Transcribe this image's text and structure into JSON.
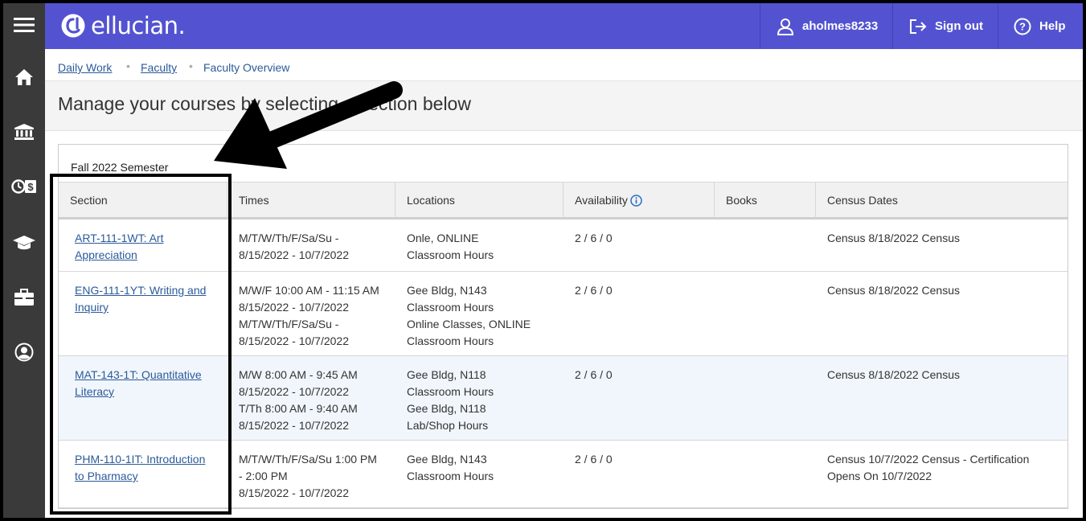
{
  "sidebar": {
    "icons": [
      "menu-icon",
      "home-icon",
      "bank-icon",
      "finance-icon",
      "graduation-cap-icon",
      "briefcase-icon",
      "user-circle-icon"
    ]
  },
  "header": {
    "logo_text": "ellucian.",
    "username": "aholmes8233",
    "signout_label": "Sign out",
    "help_label": "Help",
    "brand_color": "#5353d1"
  },
  "breadcrumb": {
    "items": [
      "Daily Work",
      "Faculty",
      "Faculty Overview"
    ]
  },
  "page": {
    "heading": "Manage your courses by selecting a section below"
  },
  "table": {
    "semester": "Fall 2022 Semester",
    "columns": [
      "Section",
      "Times",
      "Locations",
      "Availability",
      "Books",
      "Census Dates"
    ],
    "rows": [
      {
        "section": [
          "ART-111-1WT: Art",
          "Appreciation"
        ],
        "times": [
          "M/T/W/Th/F/Sa/Su -",
          "8/15/2022 - 10/7/2022"
        ],
        "locations": [
          "Onle, ONLINE",
          "Classroom Hours"
        ],
        "availability": "2 / 6 / 0",
        "books": "",
        "census": [
          "Census 8/18/2022 Census"
        ]
      },
      {
        "section": [
          "ENG-111-1YT: Writing and",
          "Inquiry"
        ],
        "times": [
          "M/W/F 10:00 AM - 11:15 AM",
          "8/15/2022 - 10/7/2022",
          "M/T/W/Th/F/Sa/Su -",
          "8/15/2022 - 10/7/2022"
        ],
        "locations": [
          "Gee Bldg, N143",
          "Classroom Hours",
          "Online Classes, ONLINE",
          "Classroom Hours"
        ],
        "availability": "2 / 6 / 0",
        "books": "",
        "census": [
          "Census 8/18/2022 Census"
        ]
      },
      {
        "section": [
          "MAT-143-1T: Quantitative",
          "Literacy"
        ],
        "times": [
          "M/W 8:00 AM - 9:45 AM",
          "8/15/2022 - 10/7/2022",
          "T/Th 8:00 AM - 9:40 AM",
          "8/15/2022 - 10/7/2022"
        ],
        "locations": [
          "Gee Bldg, N118",
          "Classroom Hours",
          "Gee Bldg, N118",
          "Lab/Shop Hours"
        ],
        "availability": "2 / 6 / 0",
        "books": "",
        "census": [
          "Census 8/18/2022 Census"
        ]
      },
      {
        "section": [
          "PHM-110-1IT: Introduction",
          "to Pharmacy"
        ],
        "times": [
          "M/T/W/Th/F/Sa/Su 1:00 PM",
          "- 2:00 PM",
          "8/15/2022 - 10/7/2022"
        ],
        "locations": [
          "Gee Bldg, N143",
          "Classroom Hours"
        ],
        "availability": "2 / 6 / 0",
        "books": "",
        "census": [
          "Census 10/7/2022 Census - Certification",
          "Opens On 10/7/2022"
        ]
      }
    ]
  }
}
